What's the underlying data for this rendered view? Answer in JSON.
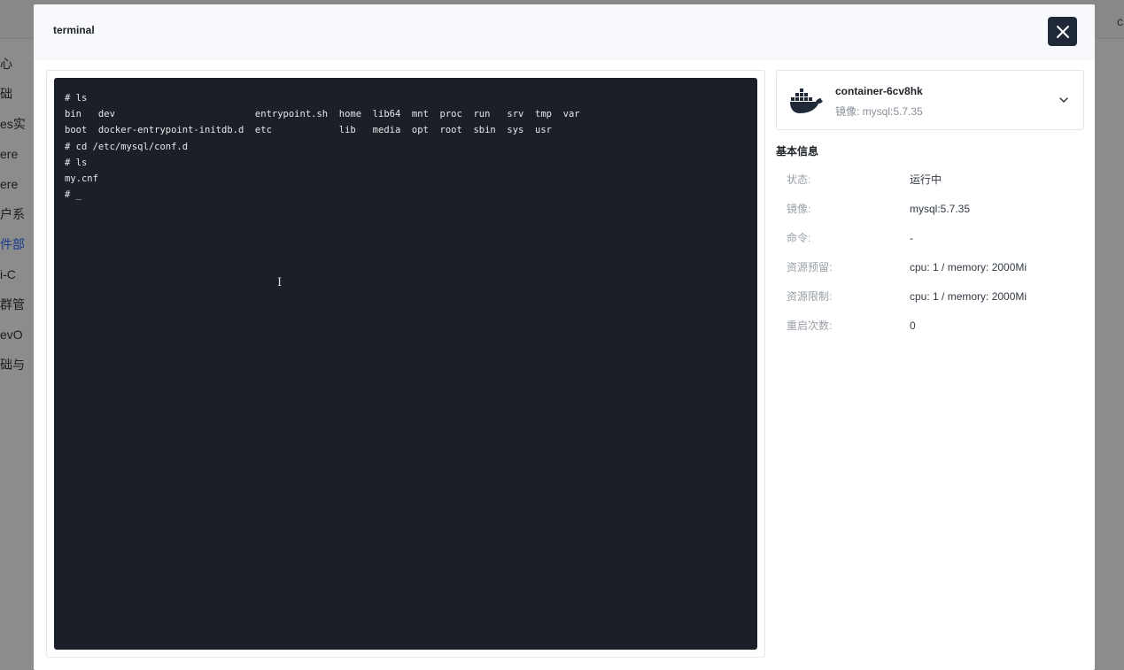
{
  "background": {
    "sidebar": [
      {
        "label": "心",
        "active": false
      },
      {
        "label": "础",
        "active": false
      },
      {
        "label": "es实",
        "active": false
      },
      {
        "label": "ere",
        "active": false
      },
      {
        "label": "ere",
        "active": false
      },
      {
        "label": "户系",
        "active": false
      },
      {
        "label": "件部",
        "active": true
      },
      {
        "label": "i-C",
        "active": false
      },
      {
        "label": "群管",
        "active": false
      },
      {
        "label": "evO",
        "active": false
      },
      {
        "label": "础与",
        "active": false
      }
    ],
    "top_right": "c"
  },
  "modal": {
    "title": "terminal",
    "close_icon": "close-icon",
    "terminal": {
      "lines": [
        "# ls",
        "bin   dev                         entrypoint.sh  home  lib64  mnt  proc  run   srv  tmp  var",
        "boot  docker-entrypoint-initdb.d  etc            lib   media  opt  root  sbin  sys  usr",
        "# cd /etc/mysql/conf.d",
        "# ls",
        "my.cnf",
        "# _"
      ],
      "background_color": "#1b1f27"
    },
    "container": {
      "icon": "docker-icon",
      "name": "container-6cv8hk",
      "image": "镜像: mysql:5.7.35"
    },
    "info": {
      "title": "基本信息",
      "rows": [
        {
          "key": "状态:",
          "value": "运行中"
        },
        {
          "key": "镜像:",
          "value": "mysql:5.7.35"
        },
        {
          "key": "命令:",
          "value": "-"
        },
        {
          "key": "资源预留:",
          "value": "cpu: 1 / memory: 2000Mi"
        },
        {
          "key": "资源限制:",
          "value": "cpu: 1 / memory: 2000Mi"
        },
        {
          "key": "重启次数:",
          "value": "0"
        }
      ]
    }
  }
}
